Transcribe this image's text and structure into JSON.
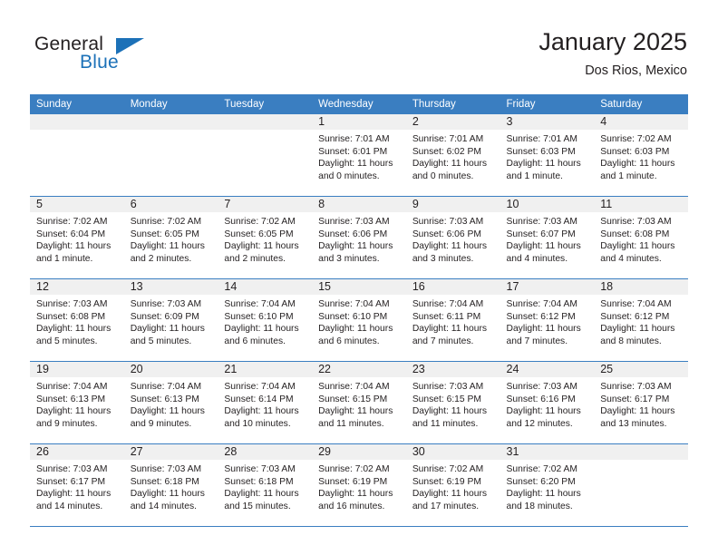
{
  "brand": {
    "word1": "General",
    "word2": "Blue",
    "accent_color": "#1c71b8"
  },
  "header": {
    "title": "January 2025",
    "subtitle": "Dos Rios, Mexico"
  },
  "theme": {
    "header_bg": "#3a7ec1",
    "daynum_bg": "#f0f0f0",
    "text": "#231f20"
  },
  "calendar": {
    "weekday_headers": [
      "Sunday",
      "Monday",
      "Tuesday",
      "Wednesday",
      "Thursday",
      "Friday",
      "Saturday"
    ],
    "weeks": [
      [
        {
          "day": "",
          "blank": true,
          "sunrise": "",
          "sunset": "",
          "daylight": ""
        },
        {
          "day": "",
          "blank": true,
          "sunrise": "",
          "sunset": "",
          "daylight": ""
        },
        {
          "day": "",
          "blank": true,
          "sunrise": "",
          "sunset": "",
          "daylight": ""
        },
        {
          "day": "1",
          "blank": false,
          "sunrise": "Sunrise: 7:01 AM",
          "sunset": "Sunset: 6:01 PM",
          "daylight": "Daylight: 11 hours and 0 minutes."
        },
        {
          "day": "2",
          "blank": false,
          "sunrise": "Sunrise: 7:01 AM",
          "sunset": "Sunset: 6:02 PM",
          "daylight": "Daylight: 11 hours and 0 minutes."
        },
        {
          "day": "3",
          "blank": false,
          "sunrise": "Sunrise: 7:01 AM",
          "sunset": "Sunset: 6:03 PM",
          "daylight": "Daylight: 11 hours and 1 minute."
        },
        {
          "day": "4",
          "blank": false,
          "sunrise": "Sunrise: 7:02 AM",
          "sunset": "Sunset: 6:03 PM",
          "daylight": "Daylight: 11 hours and 1 minute."
        }
      ],
      [
        {
          "day": "5",
          "blank": false,
          "sunrise": "Sunrise: 7:02 AM",
          "sunset": "Sunset: 6:04 PM",
          "daylight": "Daylight: 11 hours and 1 minute."
        },
        {
          "day": "6",
          "blank": false,
          "sunrise": "Sunrise: 7:02 AM",
          "sunset": "Sunset: 6:05 PM",
          "daylight": "Daylight: 11 hours and 2 minutes."
        },
        {
          "day": "7",
          "blank": false,
          "sunrise": "Sunrise: 7:02 AM",
          "sunset": "Sunset: 6:05 PM",
          "daylight": "Daylight: 11 hours and 2 minutes."
        },
        {
          "day": "8",
          "blank": false,
          "sunrise": "Sunrise: 7:03 AM",
          "sunset": "Sunset: 6:06 PM",
          "daylight": "Daylight: 11 hours and 3 minutes."
        },
        {
          "day": "9",
          "blank": false,
          "sunrise": "Sunrise: 7:03 AM",
          "sunset": "Sunset: 6:06 PM",
          "daylight": "Daylight: 11 hours and 3 minutes."
        },
        {
          "day": "10",
          "blank": false,
          "sunrise": "Sunrise: 7:03 AM",
          "sunset": "Sunset: 6:07 PM",
          "daylight": "Daylight: 11 hours and 4 minutes."
        },
        {
          "day": "11",
          "blank": false,
          "sunrise": "Sunrise: 7:03 AM",
          "sunset": "Sunset: 6:08 PM",
          "daylight": "Daylight: 11 hours and 4 minutes."
        }
      ],
      [
        {
          "day": "12",
          "blank": false,
          "sunrise": "Sunrise: 7:03 AM",
          "sunset": "Sunset: 6:08 PM",
          "daylight": "Daylight: 11 hours and 5 minutes."
        },
        {
          "day": "13",
          "blank": false,
          "sunrise": "Sunrise: 7:03 AM",
          "sunset": "Sunset: 6:09 PM",
          "daylight": "Daylight: 11 hours and 5 minutes."
        },
        {
          "day": "14",
          "blank": false,
          "sunrise": "Sunrise: 7:04 AM",
          "sunset": "Sunset: 6:10 PM",
          "daylight": "Daylight: 11 hours and 6 minutes."
        },
        {
          "day": "15",
          "blank": false,
          "sunrise": "Sunrise: 7:04 AM",
          "sunset": "Sunset: 6:10 PM",
          "daylight": "Daylight: 11 hours and 6 minutes."
        },
        {
          "day": "16",
          "blank": false,
          "sunrise": "Sunrise: 7:04 AM",
          "sunset": "Sunset: 6:11 PM",
          "daylight": "Daylight: 11 hours and 7 minutes."
        },
        {
          "day": "17",
          "blank": false,
          "sunrise": "Sunrise: 7:04 AM",
          "sunset": "Sunset: 6:12 PM",
          "daylight": "Daylight: 11 hours and 7 minutes."
        },
        {
          "day": "18",
          "blank": false,
          "sunrise": "Sunrise: 7:04 AM",
          "sunset": "Sunset: 6:12 PM",
          "daylight": "Daylight: 11 hours and 8 minutes."
        }
      ],
      [
        {
          "day": "19",
          "blank": false,
          "sunrise": "Sunrise: 7:04 AM",
          "sunset": "Sunset: 6:13 PM",
          "daylight": "Daylight: 11 hours and 9 minutes."
        },
        {
          "day": "20",
          "blank": false,
          "sunrise": "Sunrise: 7:04 AM",
          "sunset": "Sunset: 6:13 PM",
          "daylight": "Daylight: 11 hours and 9 minutes."
        },
        {
          "day": "21",
          "blank": false,
          "sunrise": "Sunrise: 7:04 AM",
          "sunset": "Sunset: 6:14 PM",
          "daylight": "Daylight: 11 hours and 10 minutes."
        },
        {
          "day": "22",
          "blank": false,
          "sunrise": "Sunrise: 7:04 AM",
          "sunset": "Sunset: 6:15 PM",
          "daylight": "Daylight: 11 hours and 11 minutes."
        },
        {
          "day": "23",
          "blank": false,
          "sunrise": "Sunrise: 7:03 AM",
          "sunset": "Sunset: 6:15 PM",
          "daylight": "Daylight: 11 hours and 11 minutes."
        },
        {
          "day": "24",
          "blank": false,
          "sunrise": "Sunrise: 7:03 AM",
          "sunset": "Sunset: 6:16 PM",
          "daylight": "Daylight: 11 hours and 12 minutes."
        },
        {
          "day": "25",
          "blank": false,
          "sunrise": "Sunrise: 7:03 AM",
          "sunset": "Sunset: 6:17 PM",
          "daylight": "Daylight: 11 hours and 13 minutes."
        }
      ],
      [
        {
          "day": "26",
          "blank": false,
          "sunrise": "Sunrise: 7:03 AM",
          "sunset": "Sunset: 6:17 PM",
          "daylight": "Daylight: 11 hours and 14 minutes."
        },
        {
          "day": "27",
          "blank": false,
          "sunrise": "Sunrise: 7:03 AM",
          "sunset": "Sunset: 6:18 PM",
          "daylight": "Daylight: 11 hours and 14 minutes."
        },
        {
          "day": "28",
          "blank": false,
          "sunrise": "Sunrise: 7:03 AM",
          "sunset": "Sunset: 6:18 PM",
          "daylight": "Daylight: 11 hours and 15 minutes."
        },
        {
          "day": "29",
          "blank": false,
          "sunrise": "Sunrise: 7:02 AM",
          "sunset": "Sunset: 6:19 PM",
          "daylight": "Daylight: 11 hours and 16 minutes."
        },
        {
          "day": "30",
          "blank": false,
          "sunrise": "Sunrise: 7:02 AM",
          "sunset": "Sunset: 6:19 PM",
          "daylight": "Daylight: 11 hours and 17 minutes."
        },
        {
          "day": "31",
          "blank": false,
          "sunrise": "Sunrise: 7:02 AM",
          "sunset": "Sunset: 6:20 PM",
          "daylight": "Daylight: 11 hours and 18 minutes."
        },
        {
          "day": "",
          "blank": true,
          "sunrise": "",
          "sunset": "",
          "daylight": ""
        }
      ]
    ]
  }
}
